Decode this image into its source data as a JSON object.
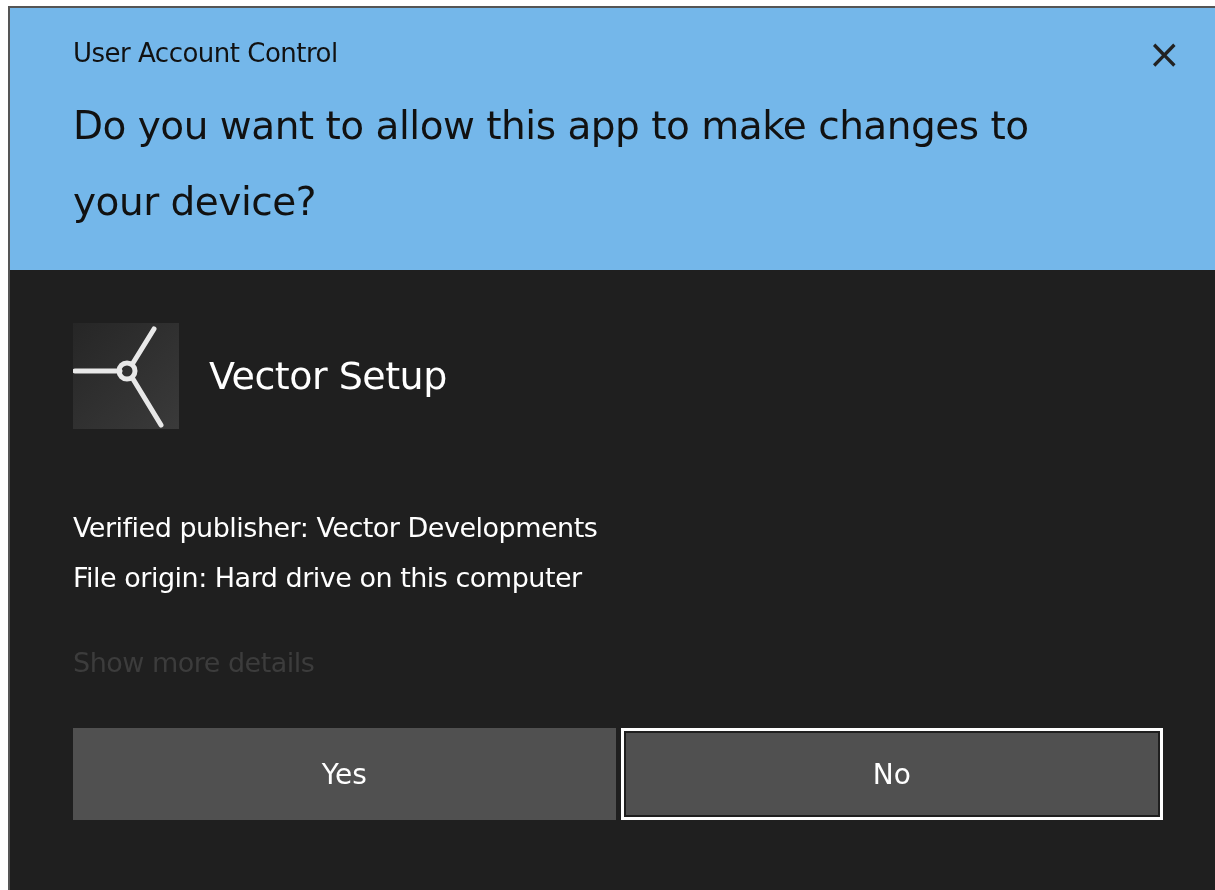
{
  "window": {
    "title": "User Account Control",
    "close": "×"
  },
  "heading": "Do you want to allow this app to make changes to your device?",
  "app": {
    "name": "Vector Setup"
  },
  "details": [
    "Verified publisher: Vector Developments",
    "File origin: Hard drive on this computer"
  ],
  "more_details": {
    "label": "Show more details",
    "disabled": true
  },
  "buttons": [
    {
      "label": "Yes",
      "focused": false
    },
    {
      "label": "No",
      "focused": true
    }
  ]
}
